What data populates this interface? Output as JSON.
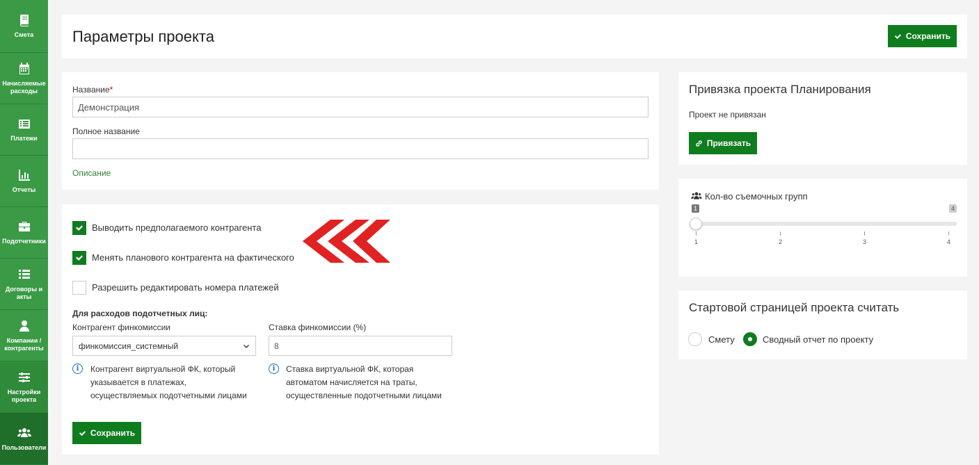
{
  "sidebar": {
    "items": [
      {
        "label": "Смета",
        "icon": "book-icon"
      },
      {
        "label": "Начисляемые расходы",
        "icon": "calendar-icon"
      },
      {
        "label": "Платежи",
        "icon": "list-icon"
      },
      {
        "label": "Отчеты",
        "icon": "bar-chart-icon"
      },
      {
        "label": "Подотчетники",
        "icon": "briefcase-icon"
      },
      {
        "label": "Договоры и акты",
        "icon": "list-icon"
      },
      {
        "label": "Компании / контрагенты",
        "icon": "user-icon"
      },
      {
        "label": "Настройки проекта",
        "icon": "sliders-icon"
      },
      {
        "label": "Пользователи",
        "icon": "users-icon"
      }
    ]
  },
  "header": {
    "title": "Параметры проекта",
    "save_label": "Сохранить"
  },
  "project": {
    "name_label": "Название",
    "name_required": "*",
    "name_value": "Демонстрация",
    "fullname_label": "Полное название",
    "fullname_value": "",
    "description_link": "Описание"
  },
  "options": {
    "show_expected_counterparty": "Выводить предполагаемого контрагента",
    "change_planned_to_actual": "Менять планового контрагента на фактического",
    "allow_edit_payment_numbers": "Разрешить редактировать номера платежей",
    "accountable_heading": "Для расходов подотчетных лиц:",
    "commission_counterparty_label": "Контрагент финкомиссии",
    "commission_counterparty_value": "финкомиссия_системный",
    "commission_rate_label": "Ставка финкомиссии (%)",
    "commission_rate_value": "8",
    "hint_counterparty": [
      "Контрагент виртуальной ФК, который",
      "указывается в платежах,",
      "осуществляемых подотчетными лицами"
    ],
    "hint_rate": [
      "Ставка виртуальной ФК, которая",
      "автоматом начисляется на траты,",
      "осуществленные подотчетными лицами"
    ],
    "save_label": "Сохранить"
  },
  "planning": {
    "title": "Привязка проекта Планирования",
    "status": "Проект не привязан",
    "link_label": "Привязать"
  },
  "crews": {
    "title": "Кол-во съемочных групп",
    "value": 1,
    "min_badge": "1",
    "max_badge": "4",
    "ticks": [
      "1",
      "2",
      "3",
      "4"
    ]
  },
  "start_page": {
    "title": "Стартовой страницей проекта считать",
    "options": [
      "Смету",
      "Сводный отчет по проекту"
    ],
    "selected": 1
  },
  "colors": {
    "sidebar": "#3a9a45",
    "primary_button": "#0f7c1e",
    "arrow": "#e02222"
  }
}
